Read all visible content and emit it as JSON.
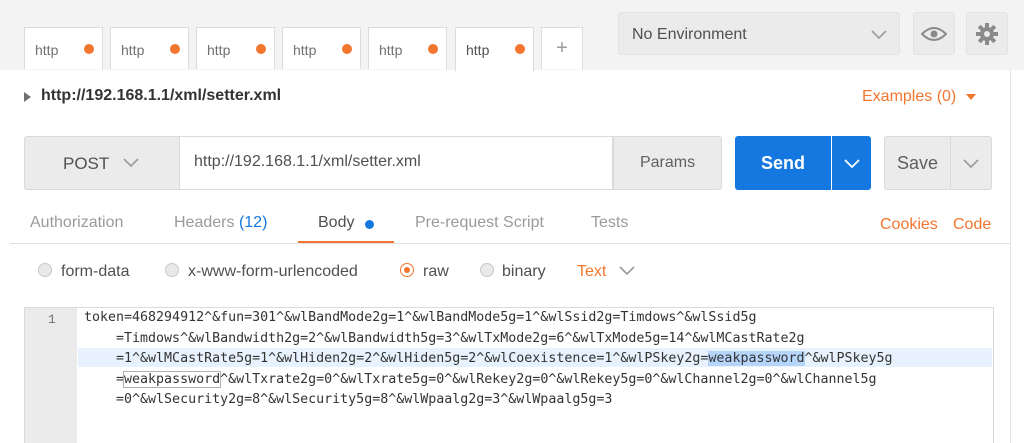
{
  "tabs": [
    {
      "label": "http"
    },
    {
      "label": "http"
    },
    {
      "label": "http"
    },
    {
      "label": "http"
    },
    {
      "label": "http"
    },
    {
      "label": "http"
    }
  ],
  "add_tab": "+",
  "environment": {
    "selected": "No Environment"
  },
  "request": {
    "title": "http://192.168.1.1/xml/setter.xml",
    "examples": "Examples (0)",
    "method": "POST",
    "url": "http://192.168.1.1/xml/setter.xml",
    "params": "Params",
    "send": "Send",
    "save": "Save"
  },
  "subtabs": {
    "authorization": "Authorization",
    "headers": "Headers",
    "headers_count": "(12)",
    "body": "Body",
    "prerequest": "Pre-request Script",
    "tests": "Tests",
    "cookies": "Cookies",
    "code": "Code"
  },
  "body_options": {
    "form_data": "form-data",
    "urlencoded": "x-www-form-urlencoded",
    "raw": "raw",
    "binary": "binary",
    "content_type": "Text"
  },
  "editor": {
    "line_number": "1",
    "line1": "token=468294912^&fun=301^&wlBandMode2g=1^&wlBandMode5g=1^&wlSsid2g=Timdows^&wlSsid5g",
    "line2": "    =Timdows^&wlBandwidth2g=2^&wlBandwidth5g=3^&wlTxMode2g=6^&wlTxMode5g=14^&wlMCastRate2g",
    "line3_a": "    =1^&wlMCastRate5g=1^&wlHiden2g=2^&wlHiden5g=2^&wlCoexistence=1^&wlPSkey2g=",
    "line3_sel": "weakpassword",
    "line3_b": "^&wlPSkey5g",
    "line4_a": "    =",
    "line4_match": "weakpassword",
    "line4_b": "^&wlTxrate2g=0^&wlTxrate5g=0^&wlRekey2g=0^&wlRekey5g=0^&wlChannel2g=0^&wlChannel5g",
    "line5": "    =0^&wlSecurity2g=8^&wlSecurity5g=8^&wlWpaalg2g=3^&wlWpaalg5g=3"
  },
  "colors": {
    "accent": "#f2762e",
    "primary": "#1478e0"
  }
}
